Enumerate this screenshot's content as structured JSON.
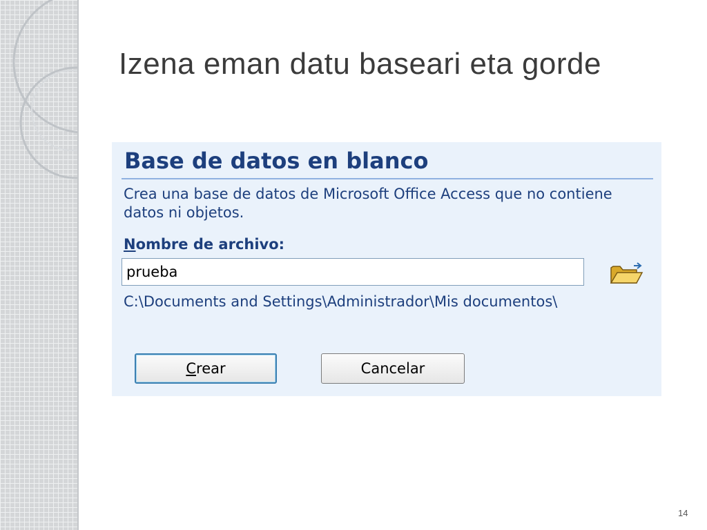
{
  "slide": {
    "title": "Izena eman datu baseari eta gorde",
    "number": "14"
  },
  "panel": {
    "heading": "Base de datos en blanco",
    "description": "Crea una base de datos de Microsoft Office Access que no contiene datos ni objetos.",
    "field_label_mnemonic": "N",
    "field_label_rest": "ombre de archivo:",
    "filename_value": "prueba",
    "folder_icon": "folder-open-icon",
    "path": "C:\\Documents and Settings\\Administrador\\Mis documentos\\",
    "create_button": {
      "mnemonic": "C",
      "rest": "rear"
    },
    "cancel_button": {
      "label": "Cancelar"
    }
  },
  "colors": {
    "panel_background": "#eaf2fb",
    "panel_text": "#1d3f7d",
    "heading_rule": "#8fb0e0",
    "default_button_border": "#3c7fb1"
  }
}
